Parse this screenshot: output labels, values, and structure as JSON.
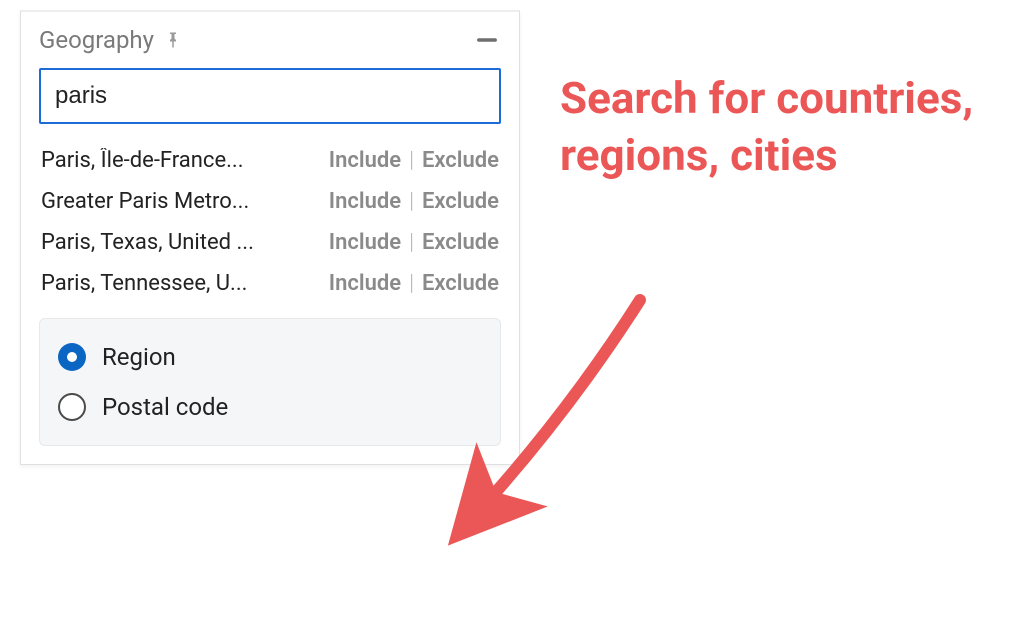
{
  "panel": {
    "title": "Geography",
    "search_value": "paris",
    "include_label": "Include",
    "exclude_label": "Exclude",
    "results": [
      {
        "label": "Paris, Île-de-France..."
      },
      {
        "label": "Greater Paris Metro..."
      },
      {
        "label": "Paris, Texas, United ..."
      },
      {
        "label": "Paris, Tennessee, U..."
      }
    ],
    "mode": {
      "region_label": "Region",
      "postal_label": "Postal code",
      "selected": "region"
    }
  },
  "annotation": {
    "text": "Search for countries, regions, cities"
  }
}
